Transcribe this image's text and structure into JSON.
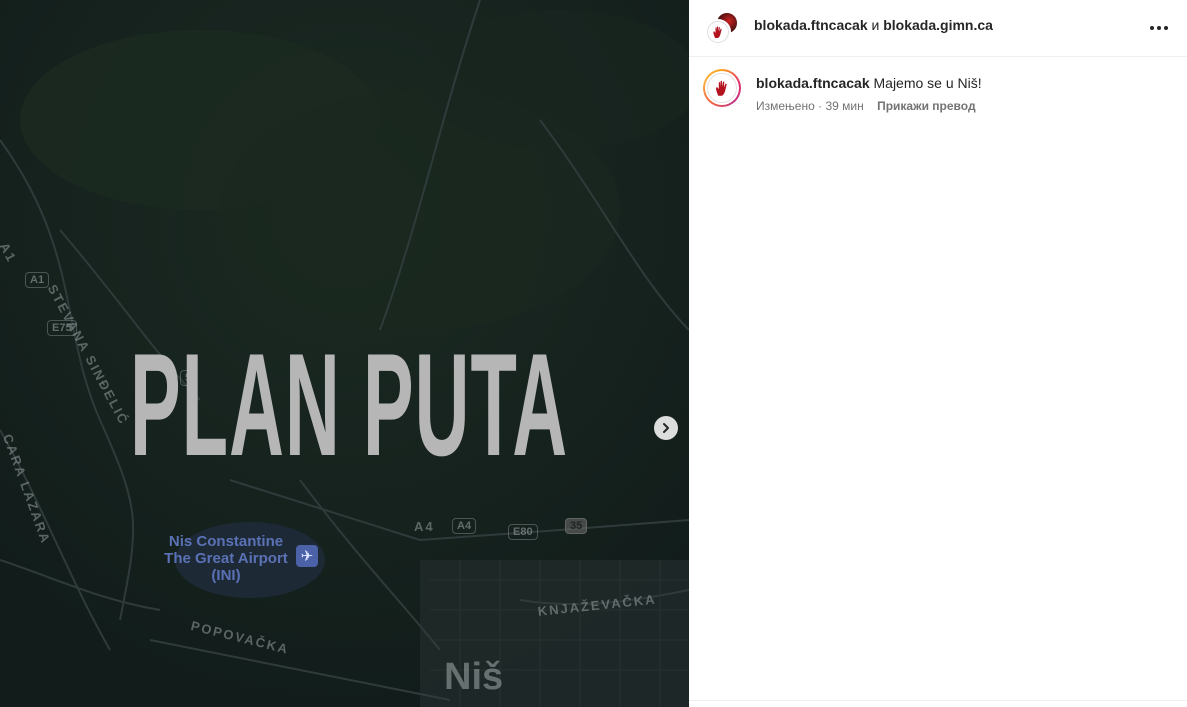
{
  "post": {
    "headline": "PLAN PUTA",
    "map": {
      "labels": {
        "stevana": "STEVANA SINĐELIĆ",
        "cara_lazara": "CARA LAZARA",
        "popovacka": "POPOVAČKA",
        "knjazevacka": "KNJAŽEVAČKA",
        "airport": "Nis Constantine The Great Airport (INI)",
        "city": "Niš",
        "road_a1_text": "A1",
        "road_a4_text": "A4"
      },
      "shields": {
        "a1": "A1",
        "e75": "E75",
        "a4": "A4",
        "e80": "E80",
        "r35": "35",
        "partial": "5"
      }
    }
  },
  "header": {
    "author1": "blokada.ftncacak",
    "conjunction": "и",
    "author2": "blokada.gimn.ca"
  },
  "caption": {
    "username": "blokada.ftncacak",
    "text": "Majemo se u Niš!",
    "edited": "Измењено",
    "separator": "·",
    "time": "39 мин",
    "translate": "Прикажи превод"
  },
  "icons": {
    "next": "chevron-right-icon",
    "more": "more-horizontal-icon",
    "airport": "airplane-icon",
    "avatar": "red-hand-icon"
  }
}
